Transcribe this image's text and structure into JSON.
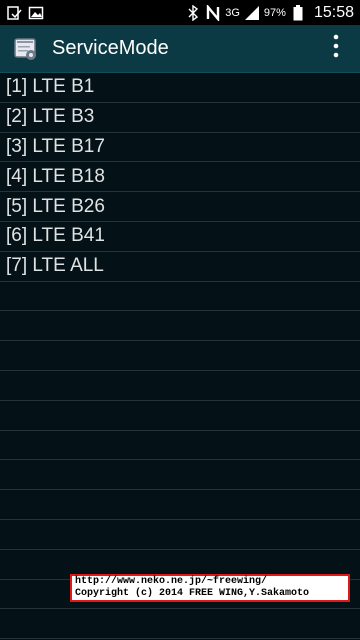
{
  "status_bar": {
    "network": "3G",
    "battery_percent": "97%",
    "time": "15:58",
    "icons": [
      "notification-check-icon",
      "image-icon",
      "bluetooth-icon",
      "nfc-icon",
      "signal-icon",
      "battery-icon"
    ]
  },
  "action_bar": {
    "title": "ServiceMode",
    "icon": "service-mode-app-icon",
    "menu_icon": "overflow-menu-icon"
  },
  "list": {
    "items": [
      {
        "label": "[1] LTE B1"
      },
      {
        "label": "[2] LTE B3"
      },
      {
        "label": "[3] LTE B17"
      },
      {
        "label": "[4] LTE B18"
      },
      {
        "label": "[5] LTE B26"
      },
      {
        "label": "[6] LTE B41"
      },
      {
        "label": "[7] LTE ALL"
      },
      {
        "label": ""
      },
      {
        "label": ""
      },
      {
        "label": ""
      },
      {
        "label": ""
      },
      {
        "label": ""
      },
      {
        "label": ""
      },
      {
        "label": ""
      },
      {
        "label": ""
      },
      {
        "label": ""
      },
      {
        "label": ""
      },
      {
        "label": ""
      },
      {
        "label": ""
      }
    ]
  },
  "credit": {
    "line1": "http://www.neko.ne.jp/~freewing/",
    "line2": "Copyright (c) 2014 FREE WING,Y.Sakamoto"
  }
}
